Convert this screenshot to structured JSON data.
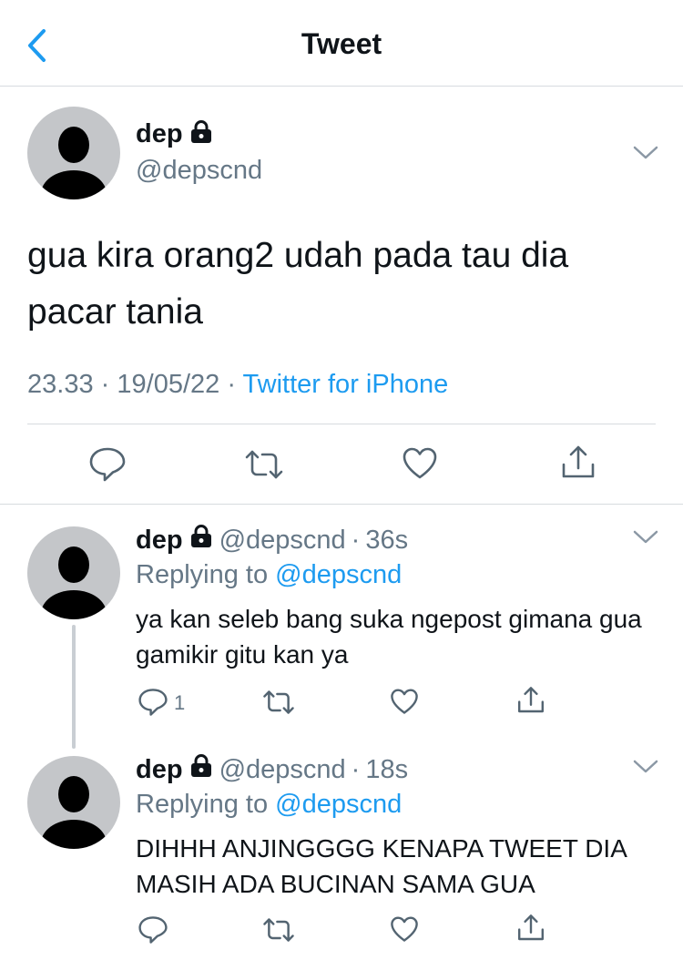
{
  "header": {
    "title": "Tweet"
  },
  "main_tweet": {
    "name": "dep",
    "handle": "@depscnd",
    "text": "gua kira orang2 udah pada tau dia pacar tania",
    "time": "23.33",
    "date": "19/05/22",
    "separator": "·",
    "source": "Twitter for iPhone"
  },
  "replies": [
    {
      "name": "dep",
      "handle": "@depscnd",
      "age": "36s",
      "replying_label": "Replying to",
      "replying_to": "@depscnd",
      "text": "ya kan seleb bang suka ngepost gimana gua gamikir gitu kan ya",
      "reply_count": "1"
    },
    {
      "name": "dep",
      "handle": "@depscnd",
      "age": "18s",
      "replying_label": "Replying to",
      "replying_to": "@depscnd",
      "text": "DIHHH ANJINGGGG KENAPA TWEET DIA MASIH ADA BUCINAN SAMA GUA",
      "reply_count": ""
    }
  ],
  "icons": {
    "back": "chevron-left-icon",
    "lock": "lock-icon",
    "menu": "chevron-down-icon",
    "reply": "reply-icon",
    "retweet": "retweet-icon",
    "like": "heart-icon",
    "share": "share-icon"
  },
  "colors": {
    "accent": "#1d9bf0",
    "secondary_text": "#657786",
    "primary_text": "#0f1419",
    "divider": "#d7dbdf"
  }
}
